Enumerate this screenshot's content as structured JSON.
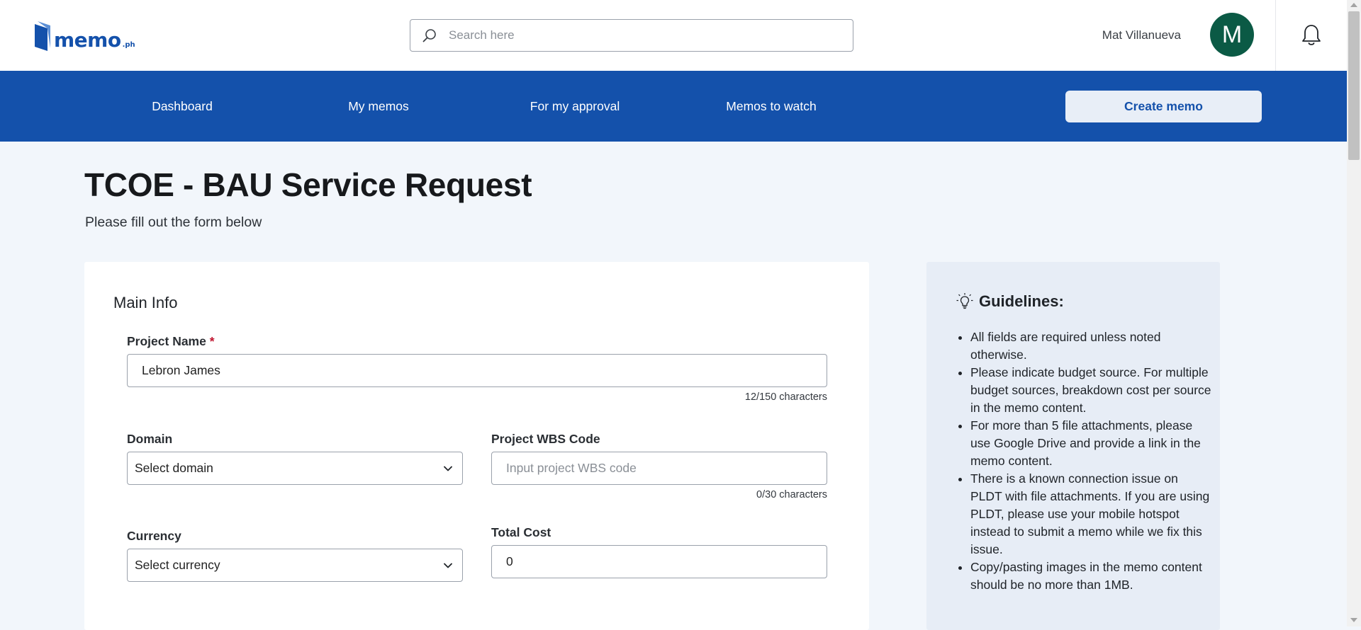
{
  "header": {
    "logo_text": "memo",
    "logo_suffix": ".ph",
    "search_placeholder": "Search here",
    "user_name": "Mat Villanueva",
    "avatar_initial": "M"
  },
  "nav": {
    "items": [
      "Dashboard",
      "My memos",
      "For my approval",
      "Memos to watch"
    ],
    "create_label": "Create memo"
  },
  "page": {
    "title": "TCOE - BAU Service Request",
    "subtitle": "Please fill out the form below"
  },
  "form": {
    "section_title": "Main Info",
    "project_name": {
      "label": "Project Name",
      "required_mark": "*",
      "value": "Lebron James",
      "counter": "12/150 characters"
    },
    "domain": {
      "label": "Domain",
      "selected": "Select domain"
    },
    "wbs": {
      "label": "Project WBS Code",
      "placeholder": "Input project WBS code",
      "value": "",
      "counter": "0/30 characters"
    },
    "currency": {
      "label": "Currency",
      "selected": "Select currency"
    },
    "total_cost": {
      "label": "Total Cost",
      "value": "0"
    }
  },
  "guidelines": {
    "title": "Guidelines:",
    "items": [
      "All fields are required unless noted otherwise.",
      "Please indicate budget source. For multiple budget sources, breakdown cost per source in the memo content.",
      "For more than 5 file attachments, please use Google Drive and provide a link in the memo content.",
      "There is a known connection issue on PLDT with file attachments. If you are using PLDT, please use your mobile hotspot instead to submit a memo while we fix this issue.",
      "Copy/pasting images in the memo content should be no more than 1MB."
    ]
  },
  "colors": {
    "brand_blue": "#1451ab",
    "avatar_green": "#0b5a45",
    "required_red": "#c0152f",
    "page_bg": "#f2f6fb"
  }
}
